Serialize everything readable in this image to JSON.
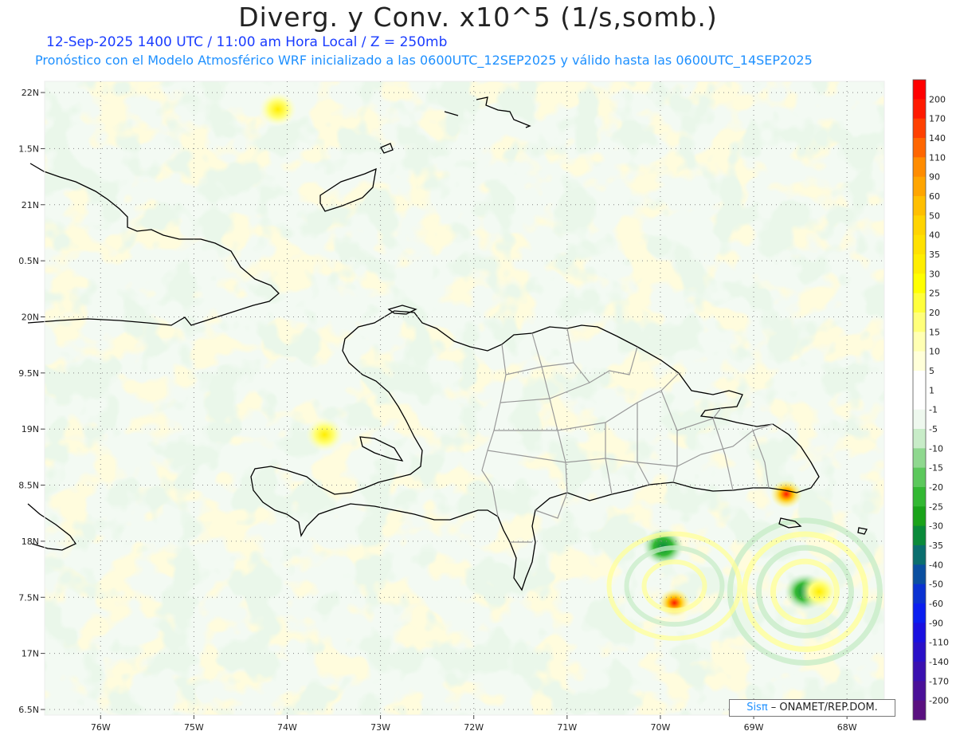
{
  "header": {
    "title": "Diverg. y Conv. x10^5 (1/s,somb.)",
    "subtitle_time": "12-Sep-2025  1400 UTC / 11:00 am Hora Local / Z = 250mb",
    "subtitle_model": "Pronóstico con el Modelo Atmosférico WRF inicializado a las 0600UTC_12SEP2025 y válido hasta las  0600UTC_14SEP2025"
  },
  "map": {
    "lon_range": [
      -76.6,
      -67.6
    ],
    "lat_range": [
      16.45,
      22.1
    ],
    "lat_ticks": [
      {
        "value": 22.0,
        "label": "22N"
      },
      {
        "value": 21.5,
        "label": "1.5N"
      },
      {
        "value": 21.0,
        "label": "21N"
      },
      {
        "value": 20.5,
        "label": "0.5N"
      },
      {
        "value": 20.0,
        "label": "20N"
      },
      {
        "value": 19.5,
        "label": "9.5N"
      },
      {
        "value": 19.0,
        "label": "19N"
      },
      {
        "value": 18.5,
        "label": "8.5N"
      },
      {
        "value": 18.0,
        "label": "18N"
      },
      {
        "value": 17.5,
        "label": "7.5N"
      },
      {
        "value": 17.0,
        "label": "17N"
      },
      {
        "value": 16.5,
        "label": "6.5N"
      }
    ],
    "lon_ticks": [
      {
        "value": -76,
        "label": "76W"
      },
      {
        "value": -75,
        "label": "75W"
      },
      {
        "value": -74,
        "label": "74W"
      },
      {
        "value": -73,
        "label": "73W"
      },
      {
        "value": -72,
        "label": "72W"
      },
      {
        "value": -71,
        "label": "71W"
      },
      {
        "value": -70,
        "label": "70W"
      },
      {
        "value": -69,
        "label": "69W"
      },
      {
        "value": -68,
        "label": "68W"
      }
    ],
    "features": [
      {
        "lon": -69.97,
        "lat": 17.95,
        "value": -30
      },
      {
        "lon": -69.85,
        "lat": 17.45,
        "value": 110
      },
      {
        "lon": -68.65,
        "lat": 18.42,
        "value": 140
      },
      {
        "lon": -68.45,
        "lat": 17.55,
        "value": -30
      },
      {
        "lon": -68.3,
        "lat": 17.55,
        "value": 25
      },
      {
        "lon": -74.1,
        "lat": 21.85,
        "value": 15
      },
      {
        "lon": -73.6,
        "lat": 18.95,
        "value": 10
      }
    ]
  },
  "colorbar": {
    "levels": [
      "200",
      "170",
      "140",
      "110",
      "90",
      "60",
      "50",
      "40",
      "35",
      "30",
      "25",
      "20",
      "15",
      "10",
      "5",
      "1",
      "-1",
      "-5",
      "-10",
      "-15",
      "-20",
      "-25",
      "-30",
      "-35",
      "-40",
      "-50",
      "-60",
      "-90",
      "-110",
      "-140",
      "-170",
      "-200"
    ],
    "colors": [
      "#ff0000",
      "#ff1a00",
      "#ff4000",
      "#ff6600",
      "#ff8c00",
      "#ffa500",
      "#ffbf00",
      "#ffd400",
      "#ffe100",
      "#ffee00",
      "#ffff00",
      "#ffff3c",
      "#ffff7a",
      "#ffffb3",
      "#ffffd9",
      "#ffffff",
      "#ffffff",
      "#eef8ee",
      "#c8ecc8",
      "#8fd88f",
      "#5cc85c",
      "#33b833",
      "#1aa31a",
      "#0a8a3a",
      "#0a6e6e",
      "#0a4fa0",
      "#0a32d2",
      "#0a1ef0",
      "#1a10e0",
      "#2a10c8",
      "#3a10b0",
      "#4a1098",
      "#5a1080"
    ]
  },
  "credit": {
    "brand": "Sisπ",
    "org": " – ONAMET/REP.DOM."
  }
}
